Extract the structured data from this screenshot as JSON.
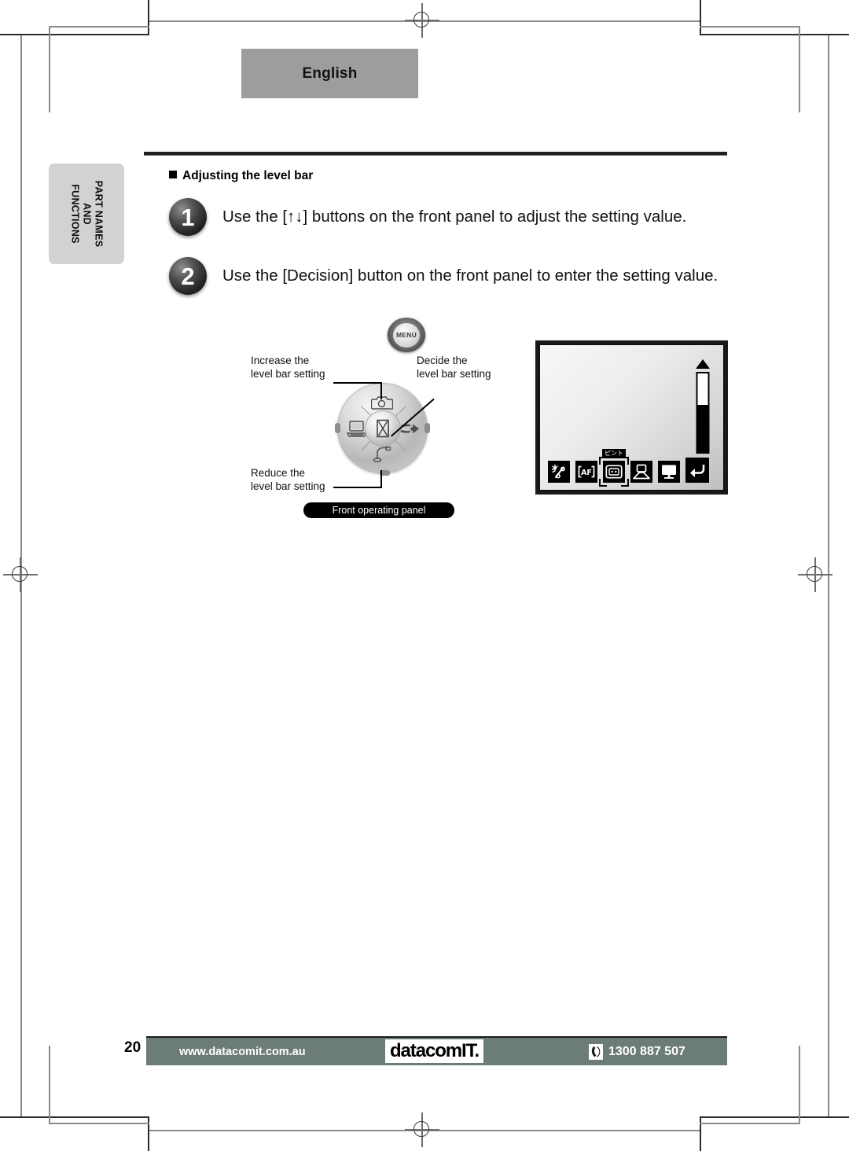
{
  "header": {
    "language_banner": "English"
  },
  "section_tab": {
    "line1": "PART NAMES",
    "line2": "AND",
    "line3": "FUNCTIONS"
  },
  "content": {
    "heading": "Adjusting the level bar",
    "steps": [
      {
        "number": "1",
        "text": "Use the [↑↓] buttons on the front panel to adjust the setting value."
      },
      {
        "number": "2",
        "text": "Use the [Decision] button on the front panel to enter the setting value."
      }
    ]
  },
  "illustration": {
    "menu_button_label": "MENU",
    "panel_caption": "Front operating panel",
    "callouts": {
      "increase": {
        "line1": "Increase the",
        "line2": "level bar setting"
      },
      "decide": {
        "line1": "Decide the",
        "line2": "level bar setting"
      },
      "reduce": {
        "line1": "Reduce the",
        "line2": "level bar setting"
      }
    },
    "dial_icons": [
      "camera-icon",
      "laptop-icon",
      "sd-card-icon",
      "desk-lamp-icon",
      "decision-center-icon"
    ],
    "screen": {
      "level_bar": {
        "increase_marker": "up-triangle-icon",
        "decrease_marker": "flower-macro-icon",
        "fill_percent": 60
      },
      "osd_buttons": [
        {
          "name": "brightness-icon",
          "selected": false
        },
        {
          "name": "autofocus-af-icon",
          "selected": false
        },
        {
          "name": "focus-frame-icon",
          "selected": true,
          "tag": "ピント"
        },
        {
          "name": "projector-icon",
          "selected": false
        },
        {
          "name": "monitor-icon",
          "selected": false
        },
        {
          "name": "return-arrow-icon",
          "selected": false
        }
      ]
    }
  },
  "footer": {
    "page_number": "20",
    "url": "www.datacomit.com.au",
    "logo": "datacomIT.",
    "phone": "1300 887 507",
    "phone_icon": "telephone-icon",
    "bar_color": "#6c7d79"
  }
}
